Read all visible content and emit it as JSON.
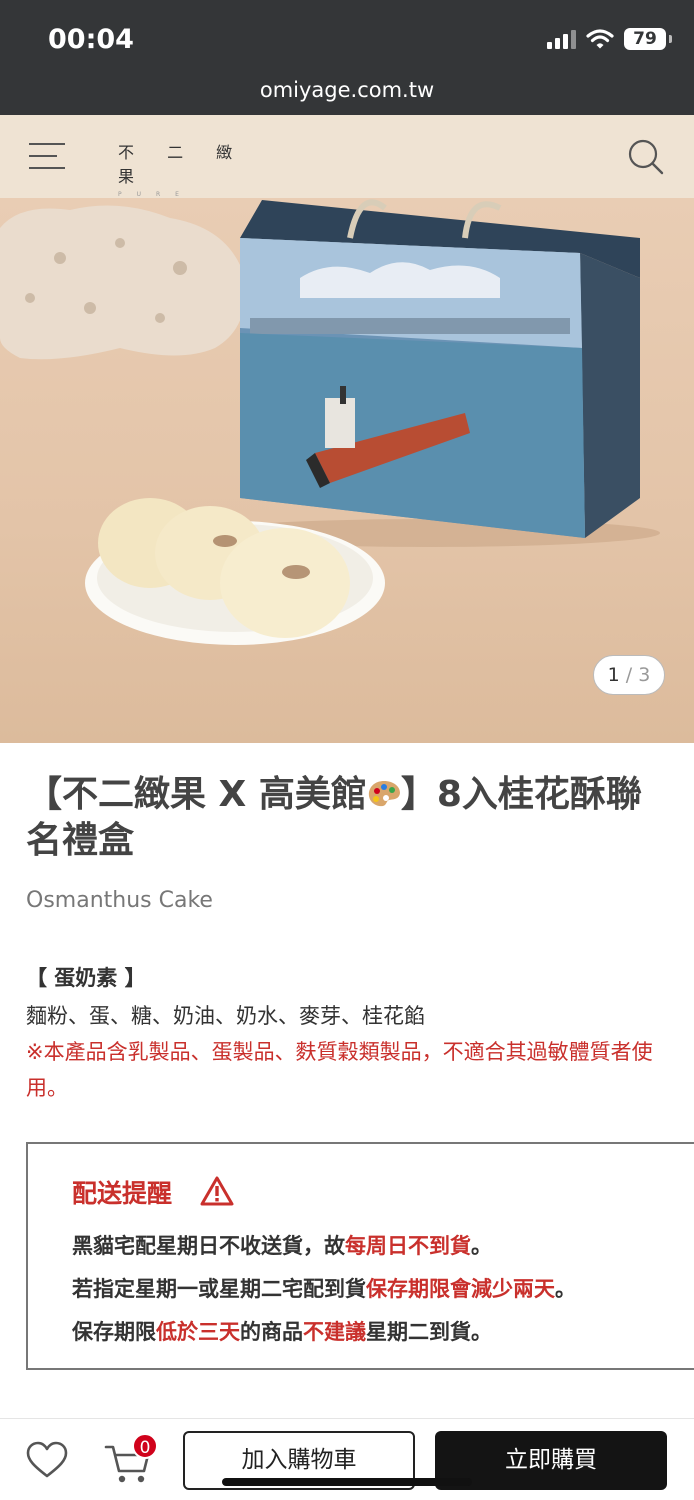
{
  "status_bar": {
    "time": "00:04",
    "battery": "79",
    "url": "omiyage.com.tw"
  },
  "site": {
    "logo_cn": "不 二 緻 果",
    "logo_en": "PURE HOME"
  },
  "hero": {
    "page_current": "1",
    "page_sep": " / ",
    "page_total": "3"
  },
  "product": {
    "title_part1": "【不二緻果 X 高美館",
    "title_part2": "】8入桂花酥聯名禮盒",
    "subtitle": "Osmanthus Cake",
    "diet_tag": "【 蛋奶素 】",
    "ingredients": "麵粉、蛋、糖、奶油、奶水、麥芽、桂花餡",
    "allergy": "※本產品含乳製品、蛋製品、麩質穀類製品，不適合其過敏體質者使用。"
  },
  "notice": {
    "title": "配送提醒",
    "line1": {
      "a": "黑貓宅配星期日不收送貨，故",
      "b": "每周日不到貨",
      "c": "。"
    },
    "line2": {
      "a": "若指定星期一或星期二宅配到貨",
      "b": "保存期限會減少兩天",
      "c": "。"
    },
    "line3": {
      "a": "保存期限",
      "b": "低於三天",
      "c": "的商品",
      "d": "不建議",
      "e": "星期二到貨。"
    }
  },
  "bottom_bar": {
    "cart_count": "0",
    "add_to_cart": "加入購物車",
    "buy_now": "立即購買"
  },
  "colors": {
    "accent_red": "#c9302c",
    "header_bg": "#efe3d3",
    "status_bg": "#343638",
    "buy_bg": "#141414"
  }
}
